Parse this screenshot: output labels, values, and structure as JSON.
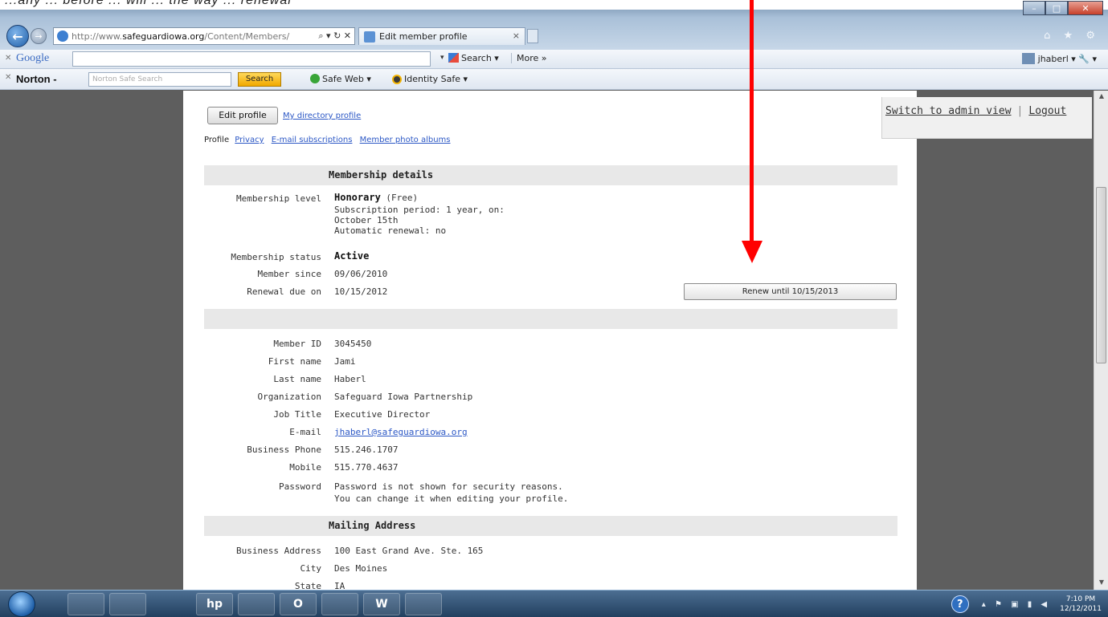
{
  "annotation": {
    "caption": "...any ... before ... will ... the way ... renewal"
  },
  "browser": {
    "url_prefix": "http://www.",
    "url_host": "safeguardiowa.org",
    "url_path": "/Content/Members/",
    "address_controls": "⌕ ▾ ↻ ✕",
    "tab_title": "Edit member profile",
    "tab_close": "×",
    "right_icons": "⌂ ★ ⚙",
    "window_controls": {
      "min": "–",
      "max": "□",
      "close": "✕"
    }
  },
  "google_toolbar": {
    "close": "✕",
    "logo": "Google",
    "dropdown": "▾",
    "search_label": "Search ▾",
    "more_label": "More »",
    "user": "jhaberl ▾",
    "tools": "🔧 ▾"
  },
  "norton_toolbar": {
    "close": "✕",
    "logo": "Norton -",
    "search_placeholder": "Norton Safe Search",
    "search_button": "Search",
    "safe_web": "Safe Web ▾",
    "identity_safe": "Identity Safe ▾"
  },
  "admin": {
    "switch_label": "Switch to admin view",
    "logout_label": "Logout",
    "separator": "|"
  },
  "profile": {
    "edit_button": "Edit profile",
    "directory_link": "My directory profile",
    "tabs": {
      "current": "Profile",
      "privacy": "Privacy",
      "email_subscriptions": "E-mail subscriptions",
      "photo_albums": "Member photo albums"
    }
  },
  "membership": {
    "section_title": "Membership details",
    "level_label": "Membership level",
    "level_value": "Honorary",
    "level_suffix": "(Free)",
    "subscription_period": "Subscription period: 1 year, on:",
    "subscription_date": "October 15th",
    "auto_renewal": "Automatic renewal: no",
    "status_label": "Membership status",
    "status_value": "Active",
    "since_label": "Member since",
    "since_value": "09/06/2010",
    "renewal_label": "Renewal due on",
    "renewal_value": "10/15/2012",
    "renew_button": "Renew until 10/15/2013"
  },
  "member_info": {
    "id_label": "Member ID",
    "id_value": "3045450",
    "first_name_label": "First name",
    "first_name_value": "Jami",
    "last_name_label": "Last name",
    "last_name_value": "Haberl",
    "org_label": "Organization",
    "org_value": "Safeguard Iowa Partnership",
    "job_label": "Job Title",
    "job_value": "Executive Director",
    "email_label": "E-mail",
    "email_value": "jhaberl@safeguardiowa.org",
    "phone_label": "Business Phone",
    "phone_value": "515.246.1707",
    "mobile_label": "Mobile",
    "mobile_value": "515.770.4637",
    "password_label": "Password",
    "password_line1": "Password is not shown for security reasons.",
    "password_line2": "You can change it when editing your profile."
  },
  "mailing": {
    "section_title": "Mailing Address",
    "address_label": "Business Address",
    "address_value": "100 East Grand Ave. Ste. 165",
    "city_label": "City",
    "city_value": "Des Moines",
    "state_label": "State",
    "state_value": "IA"
  },
  "taskbar": {
    "items": [
      "",
      "",
      "hp",
      "",
      "O",
      "",
      "W",
      ""
    ],
    "help": "?",
    "tray_icons": "▴ ⚑ ▣ ▮ ◀",
    "time": "7:10 PM",
    "date": "12/12/2011"
  },
  "colors": {
    "annotation_arrow": "#ff0000",
    "link": "#2b57c5",
    "section_bar": "#e8e8e8",
    "page_background": "#5e5e5e"
  },
  "icons": [
    "back-arrow-icon",
    "forward-arrow-icon",
    "ie-icon",
    "search-icon",
    "refresh-icon",
    "home-icon",
    "favorites-star-icon",
    "gear-icon",
    "google-search-icon",
    "user-icon",
    "wrench-icon",
    "safe-web-icon",
    "identity-safe-icon",
    "windows-start-icon",
    "help-icon"
  ]
}
